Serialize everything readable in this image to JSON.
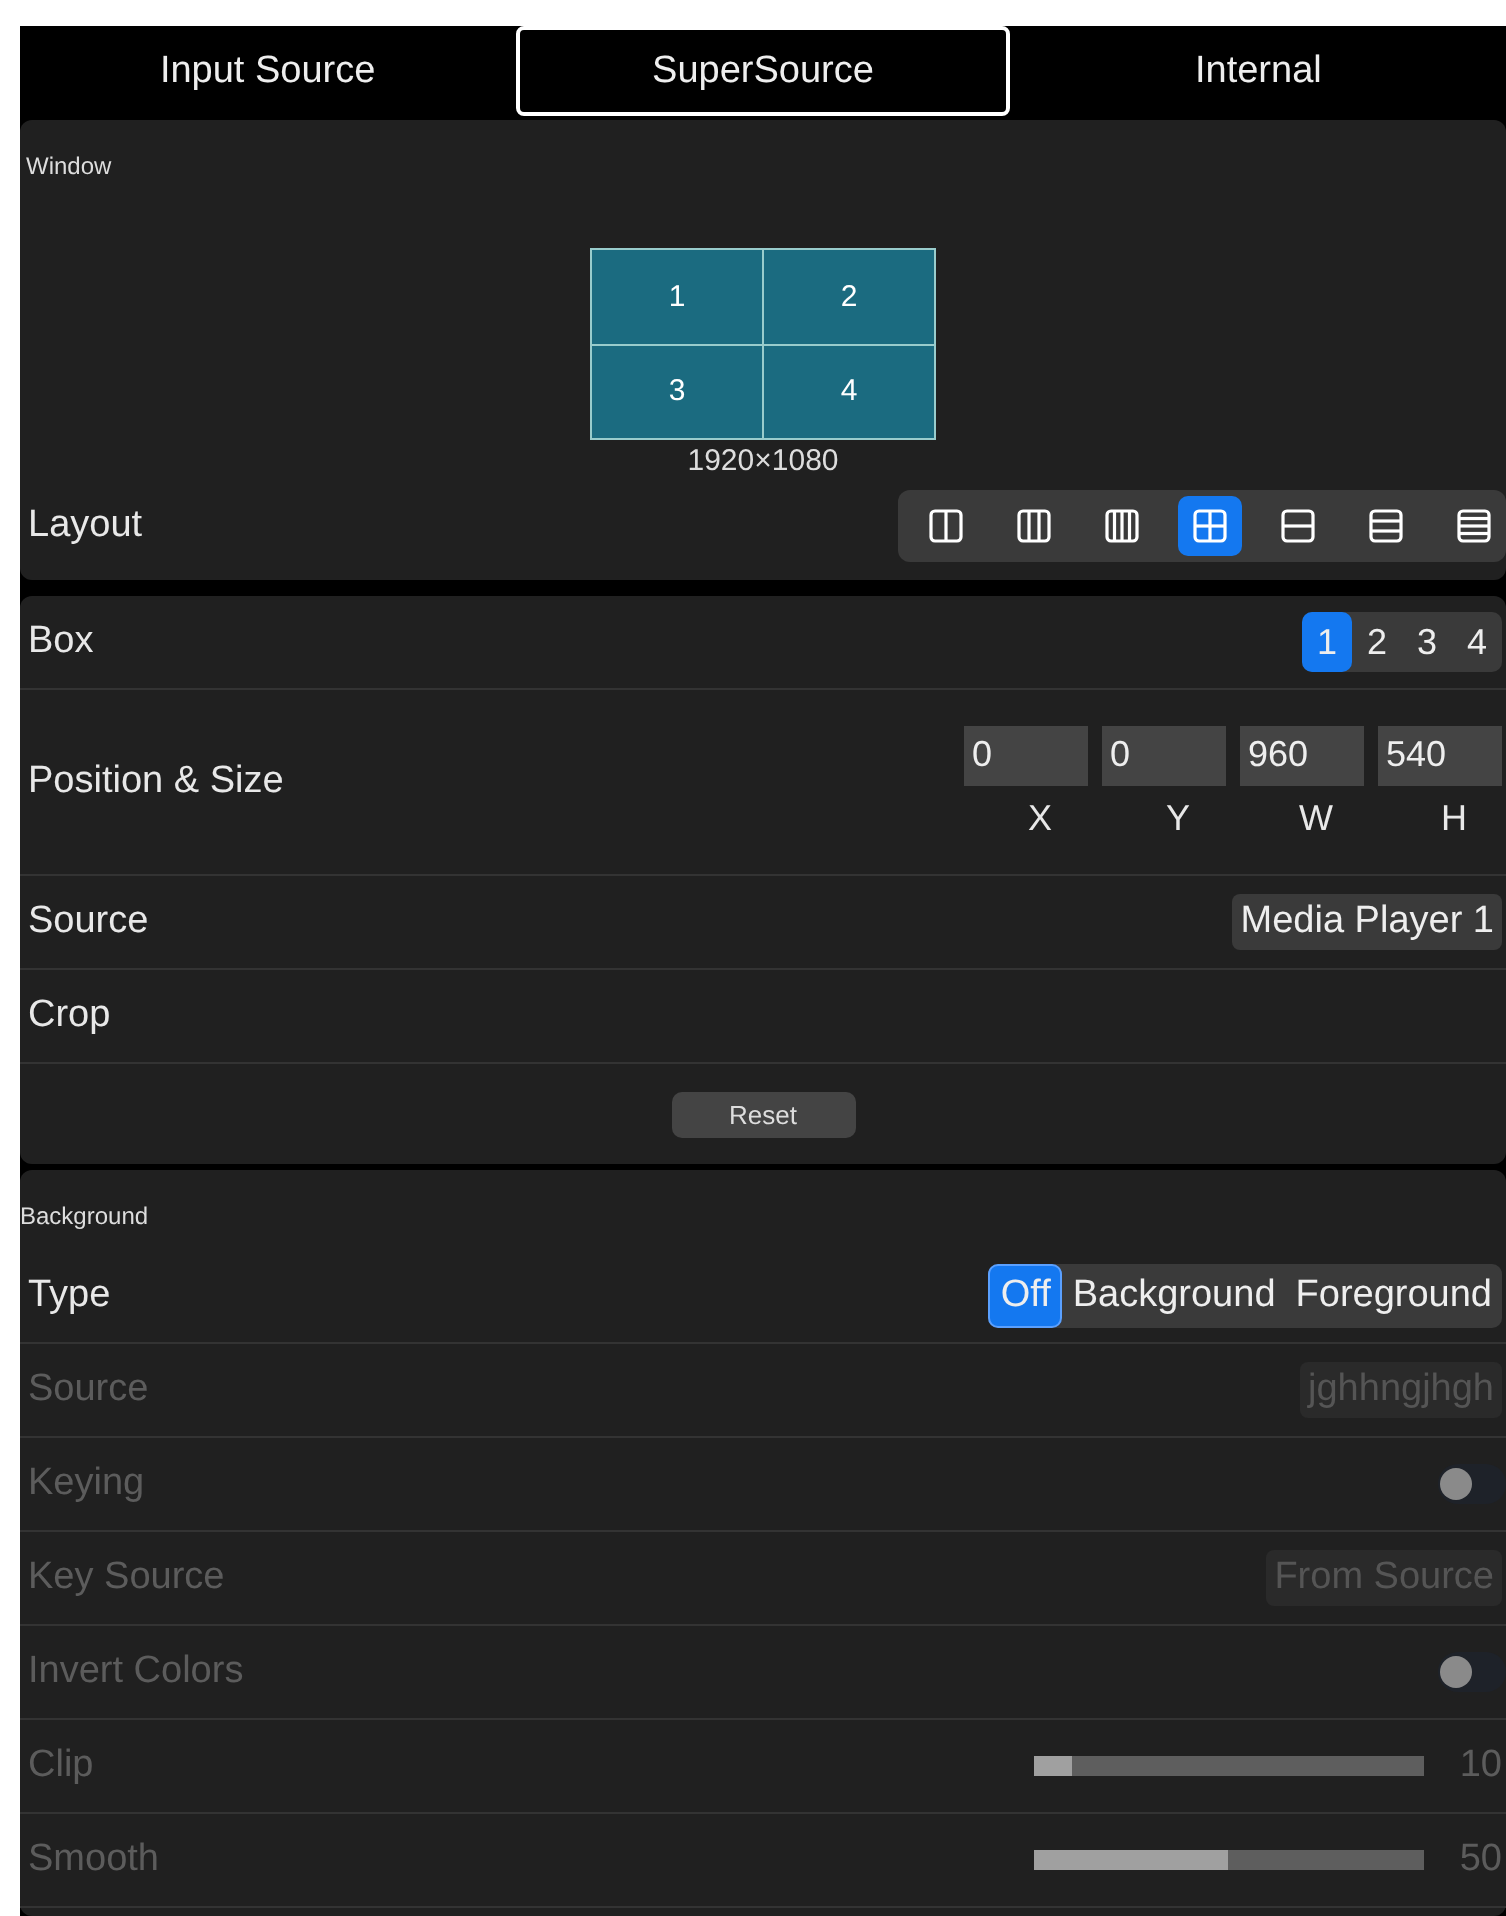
{
  "tabs": [
    {
      "label": "Input Source",
      "selected": false
    },
    {
      "label": "SuperSource",
      "selected": true
    },
    {
      "label": "Internal",
      "selected": false
    }
  ],
  "window": {
    "title": "Window",
    "cells": [
      "1",
      "2",
      "3",
      "4"
    ],
    "resolution": "1920×1080",
    "layout_label": "Layout",
    "layouts": [
      {
        "kind": "columns2",
        "selected": false
      },
      {
        "kind": "columns3",
        "selected": false
      },
      {
        "kind": "columns4",
        "selected": false
      },
      {
        "kind": "grid",
        "selected": true
      },
      {
        "kind": "rows2",
        "selected": false
      },
      {
        "kind": "rows3",
        "selected": false
      },
      {
        "kind": "rows4",
        "selected": false
      }
    ]
  },
  "box": {
    "label": "Box",
    "options": [
      {
        "label": "1",
        "selected": true
      },
      {
        "label": "2",
        "selected": false
      },
      {
        "label": "3",
        "selected": false
      },
      {
        "label": "4",
        "selected": false
      }
    ],
    "position_label": "Position & Size",
    "fields": [
      {
        "value": "0",
        "label": "X"
      },
      {
        "value": "0",
        "label": "Y"
      },
      {
        "value": "960",
        "label": "W"
      },
      {
        "value": "540",
        "label": "H"
      }
    ],
    "source_label": "Source",
    "source": "Media Player 1",
    "crop_label": "Crop",
    "reset": "Reset"
  },
  "background": {
    "title": "Background",
    "rows": [
      {
        "kind": "segmented",
        "label": "Type",
        "disabled": false,
        "options": [
          {
            "label": "Off",
            "selected": true
          },
          {
            "label": "Background",
            "selected": false
          },
          {
            "label": "Foreground",
            "selected": false
          }
        ]
      },
      {
        "kind": "select",
        "label": "Source",
        "disabled": true,
        "value": "jghhngjhgh"
      },
      {
        "kind": "toggle",
        "label": "Keying",
        "disabled": true,
        "on": false
      },
      {
        "kind": "select",
        "label": "Key Source",
        "disabled": true,
        "value": "From Source"
      },
      {
        "kind": "toggle",
        "label": "Invert Colors",
        "disabled": true,
        "on": false
      },
      {
        "kind": "slider",
        "label": "Clip",
        "disabled": true,
        "level": 0.1,
        "reading": "10"
      },
      {
        "kind": "slider",
        "label": "Smooth",
        "disabled": true,
        "level": 0.5,
        "reading": "50"
      }
    ]
  }
}
